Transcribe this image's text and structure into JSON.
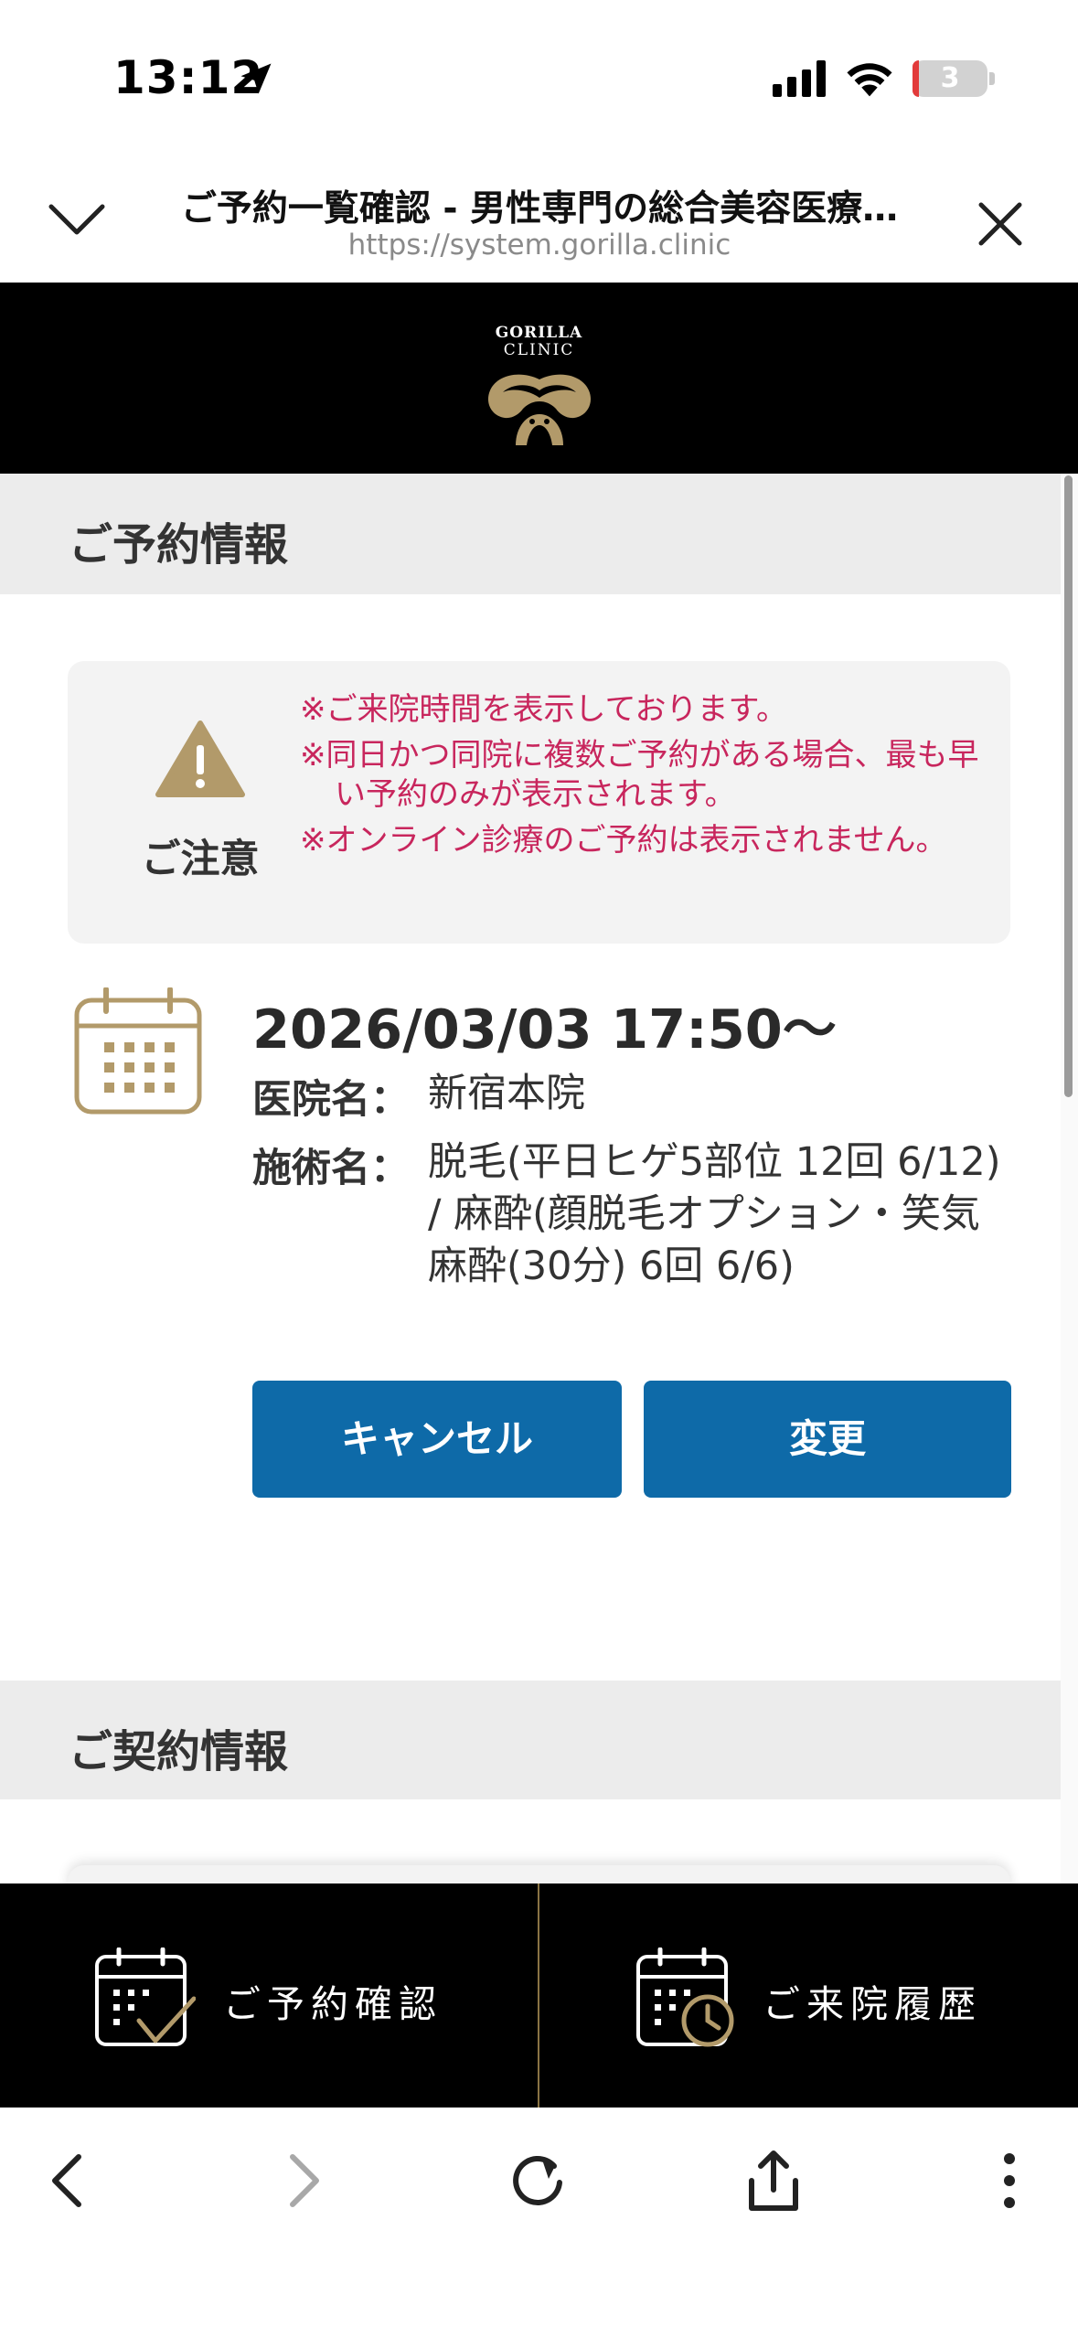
{
  "status_bar": {
    "time": "13:12",
    "battery": "3"
  },
  "browser": {
    "title": "ご予約一覧確認 - 男性専門の総合美容医療…",
    "url": "https://system.gorilla.clinic"
  },
  "site": {
    "logo_line1": "GORILLA",
    "logo_line2": "CLINIC"
  },
  "reservation_section": {
    "heading": "ご予約情報"
  },
  "notice": {
    "label": "ご注意",
    "lines": [
      "※ご来院時間を表示しております。",
      "※同日かつ同院に複数ご予約がある場合、最も早い予約のみが表示されます。",
      "※オンライン診療のご予約は表示されません。"
    ]
  },
  "reservation": {
    "datetime": "2026/03/03 17:50～",
    "clinic_label": "医院名：",
    "clinic": "新宿本院",
    "treatment_label": "施術名：",
    "treatment": "脱毛(平日ヒゲ5部位 12回 6/12) / 麻酔(顔脱毛オプション・笑気麻酔(30分) 6回 6/6)",
    "cancel_label": "キャンセル",
    "change_label": "変更"
  },
  "contract_section": {
    "heading": "ご契約情報"
  },
  "app_nav": {
    "reservations_label": "ご予約確認",
    "history_label": "ご来院履歴"
  },
  "colors": {
    "gold": "#b29a6a",
    "notice_text": "#c8265d",
    "button_blue": "#0e6aa8"
  }
}
